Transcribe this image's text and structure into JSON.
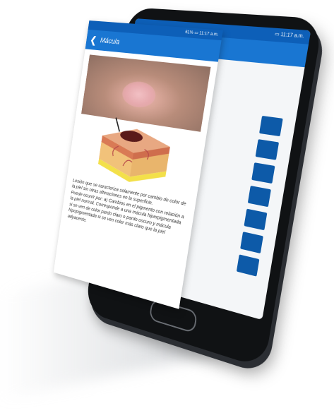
{
  "front_screen": {
    "status_text": "61% ▭ 11:17 a.m.",
    "title": "Mácula",
    "description": "Lesión que se caracteriza solamente por cambio de color de la piel sin otras alteraciones en la superficie.\nPuede ocurrir por: a) Cambios en el pigmento con relación a la piel normal. Corresponde a una mácula hiperpigmentada si se ven de color pardo claro o pardo oscuro y mácula hipopigmentada si se ven color más claro que la piel adyacente."
  },
  "back_screen": {
    "status_text": "▭ 11:17 a.m.",
    "side_buttons": 7
  },
  "icons": {
    "back": "arrow-left-icon",
    "home": "home-button"
  },
  "colors": {
    "app_bar": "#1976d2",
    "status_bar": "#0d5fb8",
    "side_button": "#0d5aa8"
  }
}
